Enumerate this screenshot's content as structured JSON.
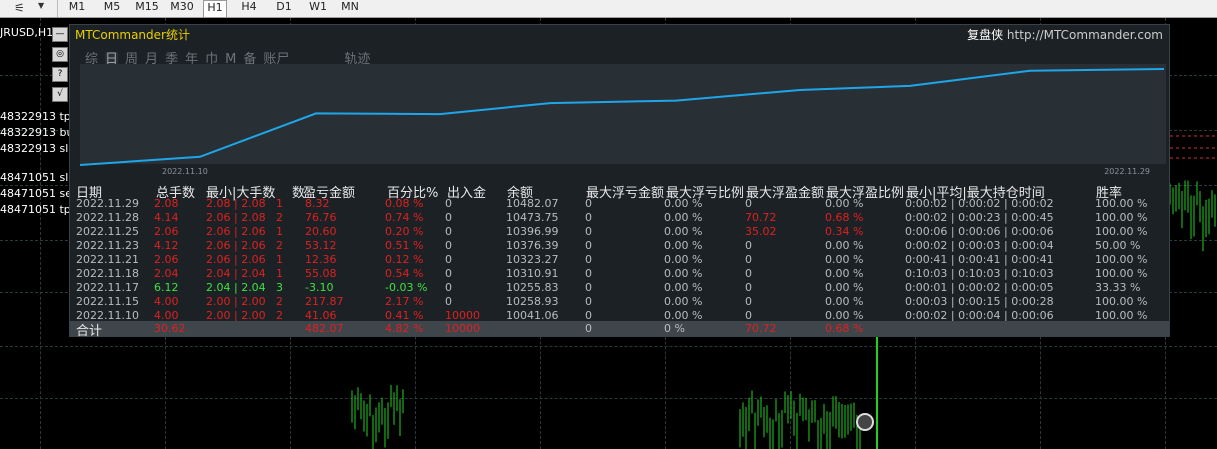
{
  "toolbar": {
    "timeframes": [
      "M1",
      "M5",
      "M15",
      "M30",
      "H1",
      "H4",
      "D1",
      "W1",
      "MN"
    ],
    "active": "H1"
  },
  "chart": {
    "symbol": "JRUSD,H1",
    "order_labels": [
      "48322913 tp",
      "48322913 bu",
      "48322913 sl",
      "48471051 sl",
      "48471051 se",
      "48471051 tp"
    ],
    "side_buttons": [
      "—",
      "◎",
      "?",
      "√"
    ]
  },
  "panel": {
    "title": "MTCommander统计",
    "brand": "复盘侠",
    "url": "http://MTCommander.com",
    "tabs": [
      "综",
      "日",
      "周",
      "月",
      "季",
      "年",
      "巾",
      "M",
      "备",
      "账尸"
    ],
    "track_tab": "轨迹",
    "graph": {
      "x_start_label": "2022.11.10",
      "x_end_label": "2022.11.29",
      "balance": [
        10000,
        10041.06,
        10258.93,
        10255.83,
        10310.91,
        10323.27,
        10376.39,
        10396.99,
        10473.75,
        10482.07
      ]
    },
    "headers": [
      "日期",
      "总手数",
      "最小|大手数",
      "数",
      "盈亏金额",
      "百分比%",
      "出入金",
      "余额",
      "最大浮亏金额",
      "最大浮亏比例",
      "最大浮盈金额",
      "最大浮盈比例",
      "最小|平均|最大持仓时间",
      "胜率"
    ],
    "rows": [
      {
        "date": "2022.11.29",
        "lots": "2.08",
        "minmax": "2.08 | 2.08",
        "n": "1",
        "pl": "8.32",
        "pct": "0.08 %",
        "io": "0",
        "bal": "10482.07",
        "mfl": "0",
        "mflp": "0.00 %",
        "mfp": "0",
        "mfpp": "0.00 %",
        "time": "0:00:02 | 0:00:02 | 0:00:02",
        "win": "100.00 %",
        "color": "r"
      },
      {
        "date": "2022.11.28",
        "lots": "4.14",
        "minmax": "2.06 | 2.08",
        "n": "2",
        "pl": "76.76",
        "pct": "0.74 %",
        "io": "0",
        "bal": "10473.75",
        "mfl": "0",
        "mflp": "0.00 %",
        "mfp": "70.72",
        "mfpp": "0.68 %",
        "time": "0:00:02 | 0:00:23 | 0:00:45",
        "win": "100.00 %",
        "color": "r"
      },
      {
        "date": "2022.11.25",
        "lots": "2.06",
        "minmax": "2.06 | 2.06",
        "n": "1",
        "pl": "20.60",
        "pct": "0.20 %",
        "io": "0",
        "bal": "10396.99",
        "mfl": "0",
        "mflp": "0.00 %",
        "mfp": "35.02",
        "mfpp": "0.34 %",
        "time": "0:00:06 | 0:00:06 | 0:00:06",
        "win": "100.00 %",
        "color": "r"
      },
      {
        "date": "2022.11.23",
        "lots": "4.12",
        "minmax": "2.06 | 2.06",
        "n": "2",
        "pl": "53.12",
        "pct": "0.51 %",
        "io": "0",
        "bal": "10376.39",
        "mfl": "0",
        "mflp": "0.00 %",
        "mfp": "0",
        "mfpp": "0.00 %",
        "time": "0:00:02 | 0:00:03 | 0:00:04",
        "win": "50.00 %",
        "color": "r"
      },
      {
        "date": "2022.11.21",
        "lots": "2.06",
        "minmax": "2.06 | 2.06",
        "n": "1",
        "pl": "12.36",
        "pct": "0.12 %",
        "io": "0",
        "bal": "10323.27",
        "mfl": "0",
        "mflp": "0.00 %",
        "mfp": "0",
        "mfpp": "0.00 %",
        "time": "0:00:41 | 0:00:41 | 0:00:41",
        "win": "100.00 %",
        "color": "r"
      },
      {
        "date": "2022.11.18",
        "lots": "2.04",
        "minmax": "2.04 | 2.04",
        "n": "1",
        "pl": "55.08",
        "pct": "0.54 %",
        "io": "0",
        "bal": "10310.91",
        "mfl": "0",
        "mflp": "0.00 %",
        "mfp": "0",
        "mfpp": "0.00 %",
        "time": "0:10:03 | 0:10:03 | 0:10:03",
        "win": "100.00 %",
        "color": "r"
      },
      {
        "date": "2022.11.17",
        "lots": "6.12",
        "minmax": "2.04 | 2.04",
        "n": "3",
        "pl": "-3.10",
        "pct": "-0.03 %",
        "io": "0",
        "bal": "10255.83",
        "mfl": "0",
        "mflp": "0.00 %",
        "mfp": "0",
        "mfpp": "0.00 %",
        "time": "0:00:01 | 0:00:02 | 0:00:05",
        "win": "33.33 %",
        "color": "g"
      },
      {
        "date": "2022.11.15",
        "lots": "4.00",
        "minmax": "2.00 | 2.00",
        "n": "2",
        "pl": "217.87",
        "pct": "2.17 %",
        "io": "0",
        "bal": "10258.93",
        "mfl": "0",
        "mflp": "0.00 %",
        "mfp": "0",
        "mfpp": "0.00 %",
        "time": "0:00:03 | 0:00:15 | 0:00:28",
        "win": "100.00 %",
        "color": "r"
      },
      {
        "date": "2022.11.10",
        "lots": "4.00",
        "minmax": "2.00 | 2.00",
        "n": "2",
        "pl": "41.06",
        "pct": "0.41 %",
        "io": "10000",
        "bal": "10041.06",
        "mfl": "0",
        "mflp": "0.00 %",
        "mfp": "0",
        "mfpp": "0.00 %",
        "time": "0:00:02 | 0:00:04 | 0:00:06",
        "win": "100.00 %",
        "color": "r"
      }
    ],
    "total": {
      "label": "合计",
      "lots": "30.62",
      "pl": "482.07",
      "pct": "4.82 %",
      "io": "10000",
      "mfl": "0",
      "mflp": "0 %",
      "mfp": "70.72",
      "mfpp": "0.68 %"
    }
  }
}
